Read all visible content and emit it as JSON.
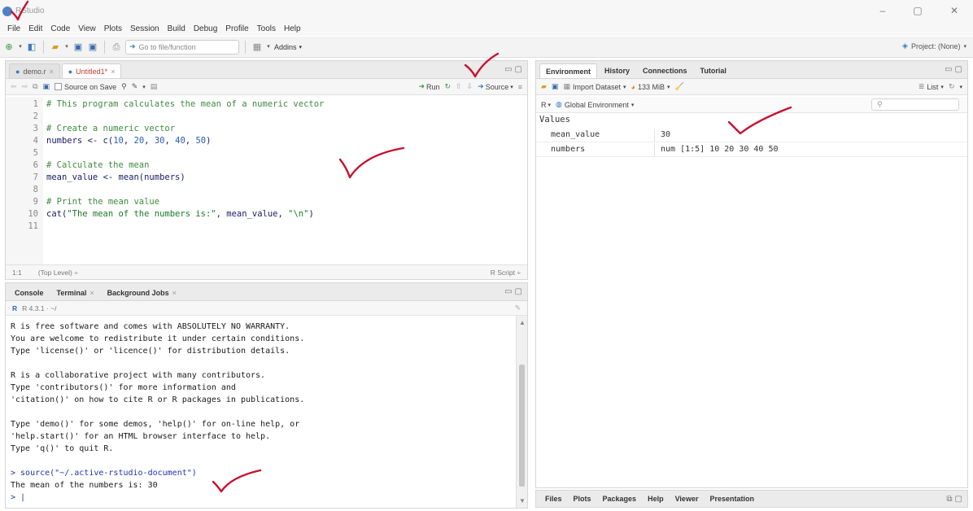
{
  "window": {
    "title": "RStudio",
    "controls": [
      "–",
      "▢",
      "✕"
    ]
  },
  "menu": [
    "File",
    "Edit",
    "Code",
    "View",
    "Plots",
    "Session",
    "Build",
    "Debug",
    "Profile",
    "Tools",
    "Help"
  ],
  "toolbar": {
    "goto_placeholder": "Go to file/function",
    "addins_label": "Addins",
    "project_label": "Project: (None)"
  },
  "editor": {
    "tabs": [
      {
        "label": "demo.r",
        "active": false
      },
      {
        "label": "Untitled1*",
        "active": true
      }
    ],
    "toolbar": {
      "source_on_save": "Source on Save",
      "run_label": "Run",
      "source_label": "Source"
    },
    "lines": [
      {
        "n": "1",
        "kind": "comment",
        "text": "# This program calculates the mean of a numeric vector"
      },
      {
        "n": "2",
        "kind": "blank",
        "text": ""
      },
      {
        "n": "3",
        "kind": "comment",
        "text": "# Create a numeric vector"
      },
      {
        "n": "4",
        "kind": "code",
        "text": "numbers <- c(10, 20, 30, 40, 50)"
      },
      {
        "n": "5",
        "kind": "blank",
        "text": ""
      },
      {
        "n": "6",
        "kind": "comment",
        "text": "# Calculate the mean"
      },
      {
        "n": "7",
        "kind": "code",
        "text": "mean_value <- mean(numbers)"
      },
      {
        "n": "8",
        "kind": "blank",
        "text": ""
      },
      {
        "n": "9",
        "kind": "comment",
        "text": "# Print the mean value"
      },
      {
        "n": "10",
        "kind": "code",
        "text": "cat(\"The mean of the numbers is:\", mean_value, \"\\n\")"
      },
      {
        "n": "11",
        "kind": "blank",
        "text": ""
      }
    ],
    "status": {
      "position": "1:1",
      "scope": "(Top Level) ÷",
      "filetype": "R Script ÷"
    }
  },
  "console": {
    "tabs": [
      "Console",
      "Terminal",
      "Background Jobs"
    ],
    "r_version": "R 4.3.1 · ~/",
    "lines": [
      {
        "kind": "out",
        "text": "R is free software and comes with ABSOLUTELY NO WARRANTY."
      },
      {
        "kind": "out",
        "text": "You are welcome to redistribute it under certain conditions."
      },
      {
        "kind": "out",
        "text": "Type 'license()' or 'licence()' for distribution details."
      },
      {
        "kind": "blank",
        "text": ""
      },
      {
        "kind": "out",
        "text": "R is a collaborative project with many contributors."
      },
      {
        "kind": "out",
        "text": "Type 'contributors()' for more information and"
      },
      {
        "kind": "out",
        "text": "'citation()' on how to cite R or R packages in publications."
      },
      {
        "kind": "blank",
        "text": ""
      },
      {
        "kind": "out",
        "text": "Type 'demo()' for some demos, 'help()' for on-line help, or"
      },
      {
        "kind": "out",
        "text": "'help.start()' for an HTML browser interface to help."
      },
      {
        "kind": "out",
        "text": "Type 'q()' to quit R."
      },
      {
        "kind": "blank",
        "text": ""
      },
      {
        "kind": "cmd",
        "text": "> source(\"~/.active-rstudio-document\")"
      },
      {
        "kind": "out",
        "text": "The mean of the numbers is: 30"
      },
      {
        "kind": "prompt",
        "text": "> |"
      }
    ]
  },
  "environment": {
    "tabs": [
      "Environment",
      "History",
      "Connections",
      "Tutorial"
    ],
    "import_label": "Import Dataset",
    "memory_label": "133 MiB",
    "list_label": "List",
    "language": "R",
    "scope_label": "Global Environment",
    "section": "Values",
    "rows": [
      {
        "name": "mean_value",
        "value": "30"
      },
      {
        "name": "numbers",
        "value": "num [1:5] 10 20 30 40 50"
      }
    ]
  },
  "files": {
    "tabs": [
      "Files",
      "Plots",
      "Packages",
      "Help",
      "Viewer",
      "Presentation"
    ]
  },
  "colors": {
    "annotation_red": "#c8102e",
    "comment_green": "#3f8a3f",
    "number_blue": "#2a5db0"
  }
}
